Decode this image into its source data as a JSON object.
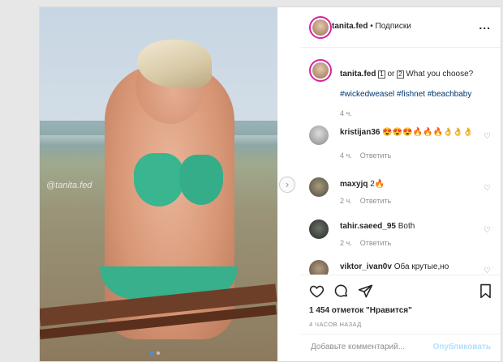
{
  "post": {
    "username": "tanita.fed",
    "separator": "•",
    "follow_label": "Подписки",
    "more_label": "...",
    "watermark": "@tanita.fed",
    "caption_prefix": "",
    "caption_box1": "1",
    "caption_or": " or ",
    "caption_box2": "2",
    "caption_suffix": " What you choose?",
    "hashtags": "#wickedweasel #fishnet #beachbaby",
    "caption_time": "4 ч.",
    "carousel_dots": 2
  },
  "comments": [
    {
      "user": "kristijan36",
      "text": "😍😍😍🔥🔥🔥👌👌👌",
      "time": "4 ч.",
      "reply": "Ответить"
    },
    {
      "user": "maxyjq",
      "text": "2🔥",
      "time": "2 ч.",
      "reply": "Ответить"
    },
    {
      "user": "tahir.saeed_95",
      "text": "Both",
      "time": "2 ч.",
      "reply": "Ответить"
    },
    {
      "user": "viktor_ivan0v",
      "text": "Оба крутые,но",
      "time": "",
      "reply": ""
    }
  ],
  "actions": {
    "like_icon": "heart-outline-icon",
    "comment_icon": "comment-icon",
    "share_icon": "share-icon",
    "save_icon": "bookmark-icon",
    "likes_text": "1 454 отметок \"Нравится\"",
    "time_ago": "4 ЧАСОВ НАЗАД"
  },
  "composer": {
    "placeholder": "Добавьте комментарий...",
    "publish_label": "Опубликовать"
  },
  "colors": {
    "link": "#00376b",
    "publish_disabled": "#b2dffc",
    "muted": "#8e8e8e",
    "bikini": "#39b58f"
  }
}
